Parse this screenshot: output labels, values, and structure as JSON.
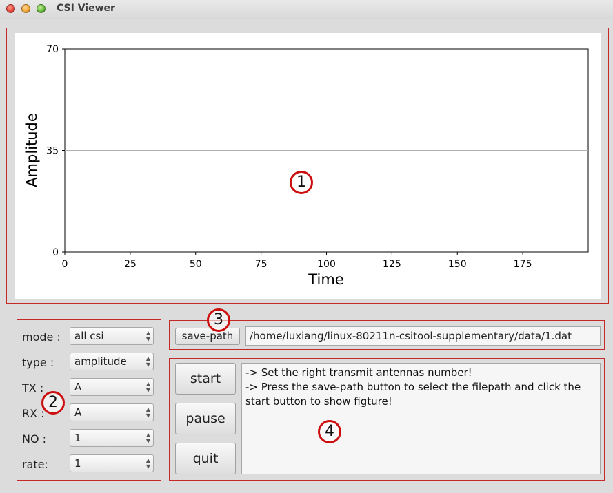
{
  "window": {
    "title": "CSI Viewer"
  },
  "chart_data": {
    "type": "line",
    "title": "",
    "xlabel": "Time",
    "ylabel": "Amplitude",
    "xlim": [
      0,
      200
    ],
    "ylim": [
      0,
      70
    ],
    "x_ticks": [
      "0",
      "25",
      "50",
      "75",
      "100",
      "125",
      "150",
      "175"
    ],
    "y_ticks": [
      "0",
      "35",
      "70"
    ],
    "gridlines_y": [
      35
    ],
    "series": []
  },
  "controls": {
    "mode": {
      "label": "mode :",
      "value": "all csi"
    },
    "type": {
      "label": "type :",
      "value": "amplitude"
    },
    "tx": {
      "label": "TX :",
      "value": "A"
    },
    "rx": {
      "label": "RX :",
      "value": "A"
    },
    "no": {
      "label": "NO :",
      "value": "1"
    },
    "rate": {
      "label": "rate:",
      "value": "1"
    }
  },
  "save": {
    "button": "save-path",
    "path": "/home/luxiang/linux-80211n-csitool-supplementary/data/1.dat"
  },
  "actions": {
    "start": "start",
    "pause": "pause",
    "quit": "quit"
  },
  "log_lines": [
    "-> Set the right transmit antennas number!",
    "-> Press the save-path button to select the filepath and click the start button to show figture!"
  ],
  "markers": {
    "m1": "1",
    "m2": "2",
    "m3": "3",
    "m4": "4"
  },
  "colors": {
    "annotation": "#cc1010",
    "grid": "#b0b0b0"
  }
}
